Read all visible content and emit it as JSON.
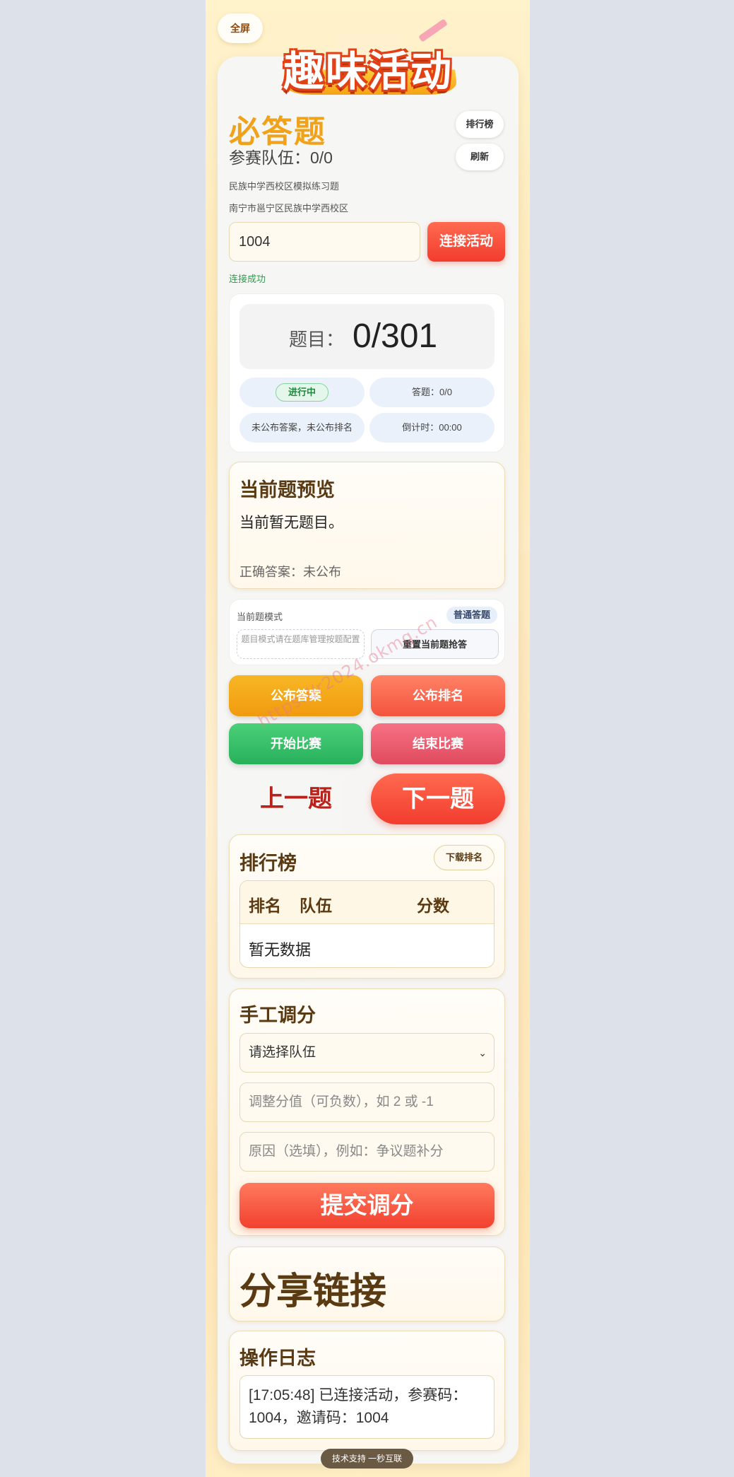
{
  "fullscreen_label": "全屏",
  "logo_text": "趣味活动",
  "title": "必答题",
  "teams_text": "参赛队伍：0/0",
  "leaderboard_label": "排行榜",
  "refresh_label": "刷新",
  "exam_name": "民族中学西校区模拟练习题",
  "school_name": "南宁市邕宁区民族中学西校区",
  "code_input": {
    "value": "1004"
  },
  "connect_label": "连接活动",
  "connect_status": "连接成功",
  "question": {
    "label": "题目：",
    "value": "0/301"
  },
  "stats": {
    "status_badge": "进行中",
    "answered": "答题：0/0",
    "publish_state": "未公布答案，未公布排名",
    "countdown": "倒计时：00:00"
  },
  "preview": {
    "title": "当前题预览",
    "text": "当前暂无题目。",
    "answer": "正确答案：未公布"
  },
  "mode": {
    "label": "当前题模式",
    "tag": "普通答题",
    "hint": "题目模式请在题库管理按题配置",
    "reset_label": "重置当前题抢答"
  },
  "actions": {
    "publish_answer": "公布答案",
    "publish_rank": "公布排名",
    "start": "开始比赛",
    "end": "结束比赛",
    "prev": "上一题",
    "next": "下一题"
  },
  "ranking": {
    "title": "排行榜",
    "download_label": "下载排名",
    "headers": [
      "排名",
      "队伍",
      "分数"
    ],
    "empty_text": "暂无数据"
  },
  "adjust": {
    "title": "手工调分",
    "team_select": "请选择队伍",
    "score_placeholder": "调整分值（可负数），如 2 或 -1",
    "reason_placeholder": "原因（选填），例如：争议题补分",
    "submit_label": "提交调分"
  },
  "share": {
    "title": "分享链接"
  },
  "log": {
    "title": "操作日志",
    "entry": "[17:05:48] 已连接活动，参赛码：1004，邀请码：1004"
  },
  "footer": "技术支持 一秒互联",
  "watermark": "https://r2024.okmg.cn",
  "colors": {
    "accent": "#f23c2e",
    "title": "#f0a21a",
    "brown": "#5a3a12",
    "success": "#1e8a3d"
  }
}
